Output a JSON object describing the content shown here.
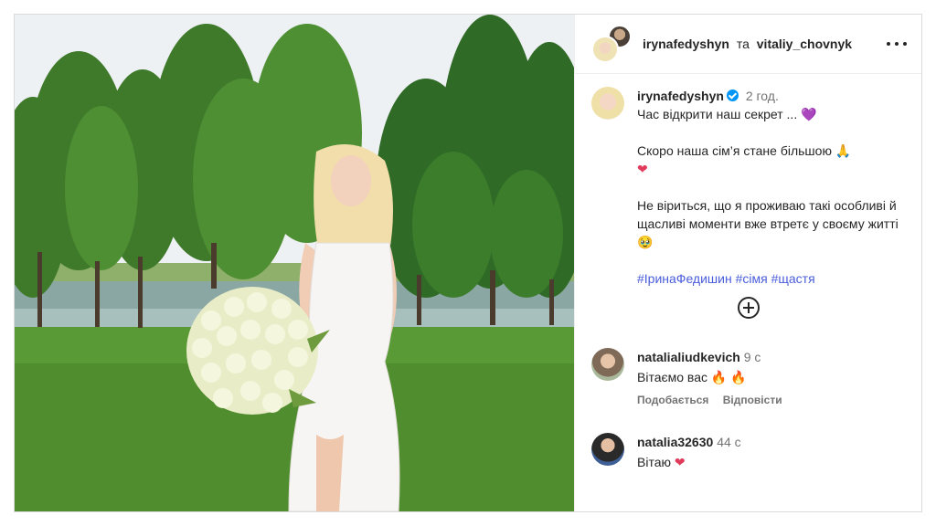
{
  "post": {
    "header": {
      "user1": "irynafedyshyn",
      "conjunction": "та",
      "user2": "vitaliy_chovnyk"
    },
    "caption": {
      "username": "irynafedyshyn",
      "time": "2 год.",
      "line1": "Час відкрити наш секрет ...",
      "line1_emoji": "💜",
      "line2": "Скоро наша сім’я стане більшою",
      "line2_emoji": "🙏",
      "line2_heart": "❤",
      "line3": "Не віриться, що я проживаю такі особливі й щасливі моменти вже втретє у своєму житті",
      "line3_emoji": "🥹",
      "hashtags": "#ІринаФедишин #сімя #щастя"
    },
    "comments": [
      {
        "username": "natalialiudkevich",
        "time": "9 с",
        "text": "Вітаємо вас",
        "emoji": "🔥 🔥",
        "like_label": "Подобається",
        "reply_label": "Відповісти"
      },
      {
        "username": "natalia32630",
        "time": "44 с",
        "text": "Вітаю",
        "emoji": "❤"
      }
    ]
  }
}
